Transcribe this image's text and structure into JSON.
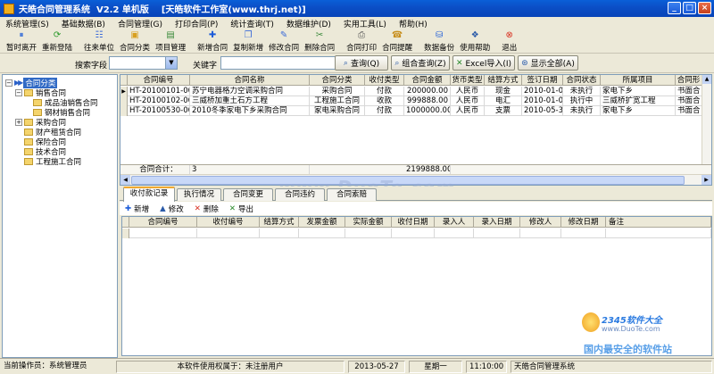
{
  "window": {
    "title": "天皓合同管理系统  V2.2 单机版    [天皓软件工作室(www.thrj.net)]"
  },
  "menu": [
    "系统管理(S)",
    "基础数据(B)",
    "合同管理(G)",
    "打印合同(P)",
    "统计查询(T)",
    "数据维护(D)",
    "实用工具(L)",
    "帮助(H)"
  ],
  "toolbar": [
    {
      "label": "暂时离开",
      "icon": "lock-icon"
    },
    {
      "label": "重新登陆",
      "icon": "relogin-icon"
    },
    {
      "label": "往来单位",
      "icon": "partner-icon"
    },
    {
      "label": "合同分类",
      "icon": "category-icon"
    },
    {
      "label": "项目管理",
      "icon": "project-icon"
    },
    {
      "label": "新增合同",
      "icon": "add-icon"
    },
    {
      "label": "复制新增",
      "icon": "copy-icon"
    },
    {
      "label": "修改合同",
      "icon": "edit-icon"
    },
    {
      "label": "删除合同",
      "icon": "delete-icon"
    },
    {
      "label": "合同打印",
      "icon": "print-icon"
    },
    {
      "label": "合同提醒",
      "icon": "reminder-icon"
    },
    {
      "label": "数据备份",
      "icon": "backup-icon"
    },
    {
      "label": "使用帮助",
      "icon": "help-icon"
    },
    {
      "label": "退出",
      "icon": "exit-icon"
    }
  ],
  "search": {
    "field_label": "搜索字段",
    "field_value": "",
    "keyword_label": "关键字",
    "keyword_value": "",
    "query_button": "查询(Q)",
    "combo_query_button": "组合查询(Z)",
    "excel_button": "Excel导入(I)",
    "show_all_button": "显示全部(A)"
  },
  "tree": {
    "root": "合同分类",
    "nodes": [
      {
        "label": "销售合同",
        "expander": "−"
      },
      {
        "label": "成品油销售合同",
        "expander": ""
      },
      {
        "label": "钢材销售合同",
        "expander": ""
      },
      {
        "label": "采购合同",
        "expander": "+"
      },
      {
        "label": "财产租赁合同",
        "expander": ""
      },
      {
        "label": "保险合同",
        "expander": ""
      },
      {
        "label": "技术合同",
        "expander": ""
      },
      {
        "label": "工程施工合同",
        "expander": ""
      }
    ]
  },
  "grid": {
    "columns": [
      "合同编号",
      "合同名称",
      "合同分类",
      "收付类型",
      "合同金额",
      "货币类型",
      "结算方式",
      "签订日期",
      "合同状态",
      "所属项目",
      "合同形"
    ],
    "rows": [
      [
        "HT-20100101-0001",
        "苏宁电器格力空调采购合同",
        "采购合同",
        "付款",
        "200000.00",
        "人民币",
        "现金",
        "2010-01-01",
        "未执行",
        "家电下乡",
        "书面合"
      ],
      [
        "HT-20100102-0002",
        "三威桥加重土石方工程",
        "工程施工合同",
        "收款",
        "999888.00",
        "人民币",
        "电汇",
        "2010-01-02",
        "执行中",
        "三威桥扩宽工程",
        "书面合"
      ],
      [
        "HT-20100530-0001",
        "2010冬季家电下乡采购合同",
        "家电采购合同",
        "付款",
        "1000000.00",
        "人民币",
        "支票",
        "2010-05-30",
        "未执行",
        "家电下乡",
        "书面合"
      ]
    ],
    "totals": {
      "label": "合同合计：",
      "count": "3",
      "amount": "2199888.00"
    }
  },
  "tabs": [
    "收付款记录",
    "执行情况",
    "合同变更",
    "合同违约",
    "合同索赔"
  ],
  "subtoolbar": [
    "新增",
    "修改",
    "删除",
    "导出"
  ],
  "subgrid": {
    "columns": [
      "合同编号",
      "收付编号",
      "结算方式",
      "发票金额",
      "实际金额",
      "收付日期",
      "录入人",
      "录入日期",
      "修改人",
      "修改日期",
      "备注"
    ]
  },
  "status": {
    "operator": "当前操作员：系统管理员",
    "license": "本软件使用权属于：未注册用户",
    "date": "2013-05-27",
    "weekday": "星期一",
    "time": "11:10:00",
    "appname": "天皓合同管理系统"
  },
  "watermarks": {
    "center": "www.DuoTe.com",
    "brand": "2345软件大全",
    "url": "www.DuoTe.com",
    "slogan": "国内最安全的软件站"
  },
  "colors": {
    "titlebar": "#0b4fc7",
    "selection": "#316ac5",
    "face": "#ece9d8"
  }
}
